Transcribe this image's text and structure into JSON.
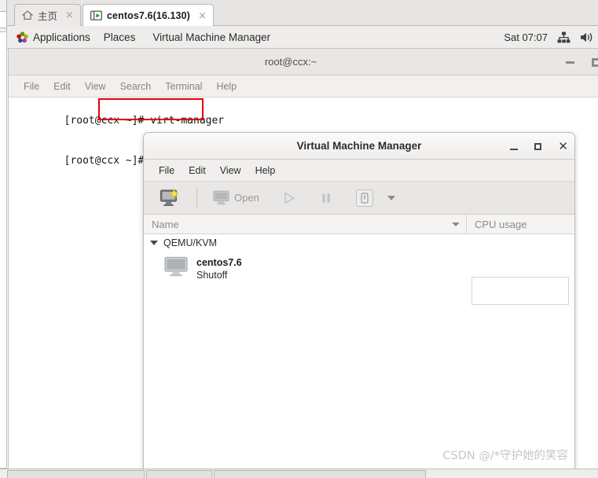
{
  "browser_tabs": {
    "tabs": [
      {
        "label": "主页",
        "icon": "home-icon",
        "close": "×",
        "active": false
      },
      {
        "label": "centos7.6(16.130)",
        "icon": "vm-console-icon",
        "close": "×",
        "active": true
      }
    ]
  },
  "gnome_panel": {
    "apps_label": "Applications",
    "apps_icon": "gnome-activities-icon",
    "places_label": "Places",
    "window_label": "Virtual Machine Manager",
    "clock": "Sat 07:07",
    "network_icon": "network-wired-icon",
    "volume_icon": "volume-speaker-icon"
  },
  "terminal": {
    "title": "root@ccx:~",
    "minimize_icon": "minimize-icon",
    "maximize_icon": "maximize-icon",
    "menu": [
      "File",
      "Edit",
      "View",
      "Search",
      "Terminal",
      "Help"
    ],
    "lines": [
      {
        "prompt": "[root@ccx ~]# ",
        "command": "virt-manager",
        "highlighted": true
      },
      {
        "prompt": "[root@ccx ~]# ",
        "command": "",
        "highlighted": false
      }
    ],
    "highlight_color": "#e60000"
  },
  "vmm": {
    "title": "Virtual Machine Manager",
    "minimize_icon": "minimize-icon",
    "maximize_icon": "maximize-icon",
    "close_icon": "close-icon",
    "menu": [
      "File",
      "Edit",
      "View",
      "Help"
    ],
    "toolbar": {
      "new_vm_icon": "new-virtual-machine-icon",
      "open_label": "Open",
      "open_icon": "monitor-icon",
      "run_icon": "play-icon",
      "pause_icon": "pause-icon",
      "shutdown_icon": "power-shutdown-icon",
      "dropdown_icon": "chevron-down-icon"
    },
    "columns": {
      "name": "Name",
      "cpu_usage": "CPU usage",
      "sort_icon": "sort-descending-icon"
    },
    "connections": [
      {
        "name": "QEMU/KVM",
        "expander_icon": "triangle-down-icon",
        "vms": [
          {
            "name": "centos7.6",
            "state": "Shutoff",
            "icon": "monitor-icon",
            "cpu_graph": ""
          }
        ]
      }
    ],
    "watermark": "CSDN @/*守护她的笑容"
  }
}
